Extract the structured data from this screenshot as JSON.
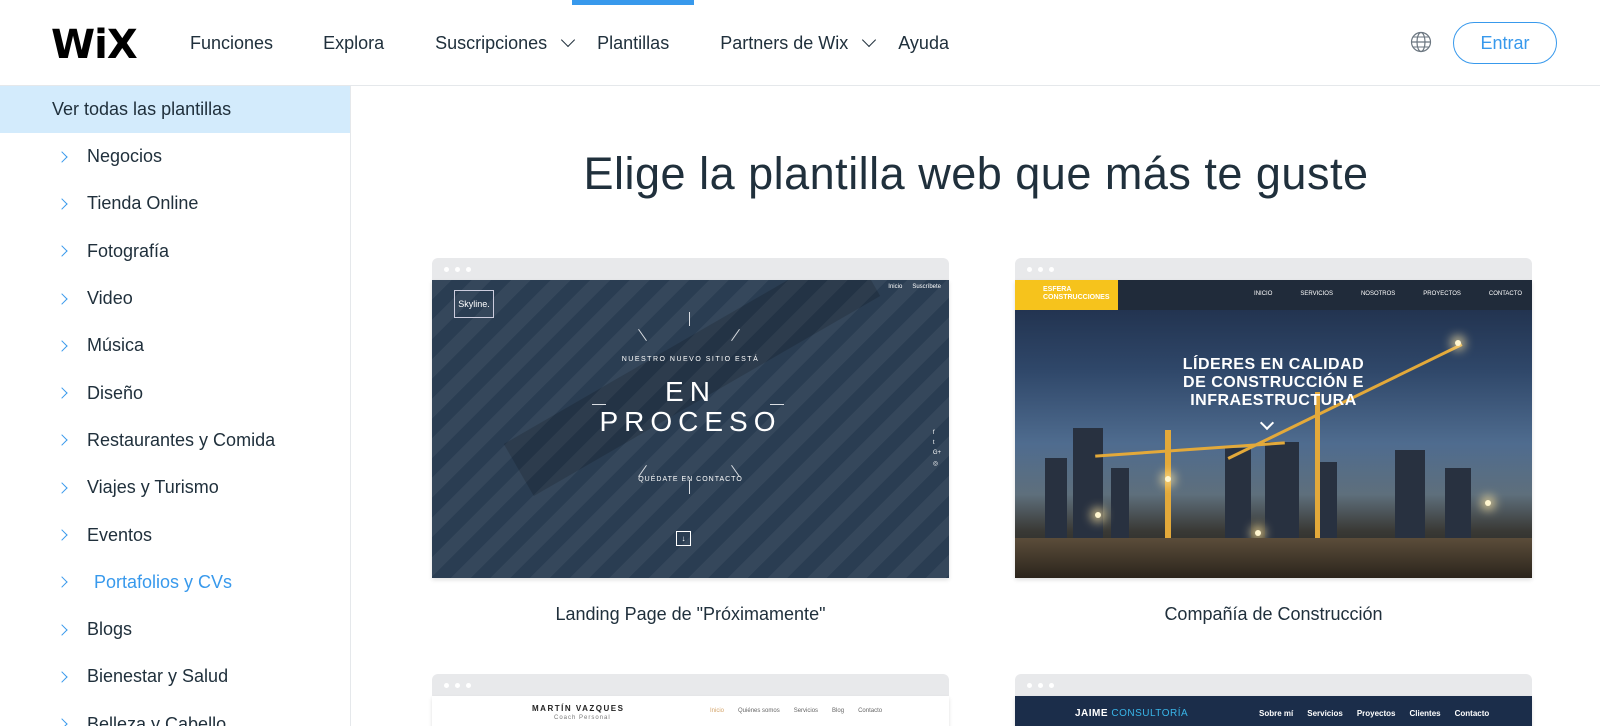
{
  "header": {
    "logo": "WiX",
    "nav": [
      {
        "label": "Funciones",
        "has_dropdown": false,
        "active": false
      },
      {
        "label": "Explora",
        "has_dropdown": false,
        "active": false
      },
      {
        "label": "Suscripciones",
        "has_dropdown": true,
        "active": false
      },
      {
        "label": "Plantillas",
        "has_dropdown": false,
        "active": true
      },
      {
        "label": "Partners de Wix",
        "has_dropdown": true,
        "active": false
      },
      {
        "label": "Ayuda",
        "has_dropdown": false,
        "active": false
      }
    ],
    "login_label": "Entrar",
    "globe_icon": "globe-icon"
  },
  "sidebar": {
    "all_label": "Ver todas las plantillas",
    "items": [
      {
        "label": "Negocios"
      },
      {
        "label": "Tienda Online"
      },
      {
        "label": "Fotografía"
      },
      {
        "label": "Video"
      },
      {
        "label": "Música"
      },
      {
        "label": "Diseño"
      },
      {
        "label": "Restaurantes y Comida"
      },
      {
        "label": "Viajes y Turismo"
      },
      {
        "label": "Eventos"
      },
      {
        "label": "Portafolios y CVs",
        "selected": true
      },
      {
        "label": "Blogs"
      },
      {
        "label": "Bienestar y Salud"
      },
      {
        "label": "Belleza y Cabello"
      }
    ]
  },
  "main": {
    "heading": "Elige la plantilla web que más te guste",
    "templates": [
      {
        "caption": "Landing Page de \"Próximamente\"",
        "preview": {
          "brand": "Skyline.",
          "top_links": [
            "Inicio",
            "Suscríbete"
          ],
          "small_text": "NUESTRO NUEVO SITIO ESTÁ",
          "big_line1": "EN",
          "big_line2": "PROCESO",
          "contact": "QUÉDATE EN CONTACTO",
          "social": [
            "f",
            "t",
            "G+",
            "◎"
          ]
        }
      },
      {
        "caption": "Compañía de Construcción",
        "preview": {
          "logo_line1": "ESFERA",
          "logo_line2": "CONSTRUCCIONES",
          "menu": [
            "INICIO",
            "SERVICIOS",
            "NOSOTROS",
            "PROYECTOS",
            "CONTACTO"
          ],
          "hero_line1": "LÍDERES EN CALIDAD",
          "hero_line2": "DE CONSTRUCCIÓN E",
          "hero_line3": "INFRAESTRUCTURA"
        }
      },
      {
        "caption": "",
        "preview": {
          "name": "MARTÍN VAZQUES",
          "role": "Coach Personal",
          "links": [
            "Inicio",
            "Quiénes somos",
            "Servicios",
            "Blog",
            "Contacto"
          ]
        }
      },
      {
        "caption": "",
        "preview": {
          "name_a": "JAIME",
          "name_b": "CONSULTORÍA",
          "links": [
            "Sobre mí",
            "Servicios",
            "Proyectos",
            "Clientes",
            "Contacto"
          ]
        }
      }
    ]
  },
  "colors": {
    "accent": "#3899ec",
    "sidebar_selected_bg": "#d3ebfc",
    "text": "#20303c"
  }
}
